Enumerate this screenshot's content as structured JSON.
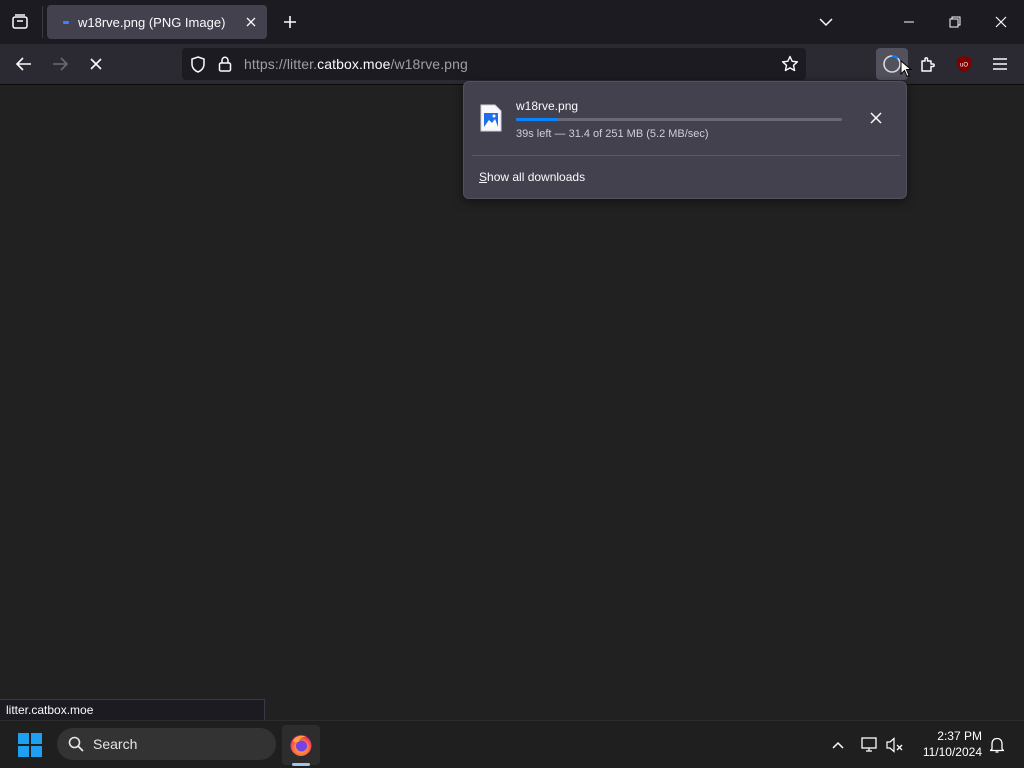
{
  "tab": {
    "title": "w18rve.png (PNG Image)"
  },
  "url": {
    "prefix": "https://litter.",
    "domain": "catbox.moe",
    "path": "/w18rve.png"
  },
  "downloads_panel": {
    "file_name": "w18rve.png",
    "status": "39s left — 31.4 of 251 MB (5.2 MB/sec)",
    "progress_fraction": 0.125,
    "show_all_key": "S",
    "show_all_rest": "how all downloads"
  },
  "status_bar": {
    "text": "litter.catbox.moe"
  },
  "taskbar": {
    "search_label": "Search",
    "time": "2:37 PM",
    "date": "11/10/2024"
  },
  "colors": {
    "accent": "#0a84ff",
    "tab_active": "#42414d",
    "toolbar": "#2b2a33",
    "content_bg": "#212121"
  },
  "icons": {
    "tab_list": "tab-list-icon",
    "back": "back-arrow-icon",
    "forward": "forward-arrow-icon",
    "stop": "stop-icon",
    "shield": "tracking-protection-shield-icon",
    "lock": "lock-icon",
    "star": "bookmark-star-icon",
    "downloads": "downloads-progress-icon",
    "extensions": "extensions-puzzle-icon",
    "ublock": "ublock-origin-icon",
    "menu": "hamburger-menu-icon"
  }
}
